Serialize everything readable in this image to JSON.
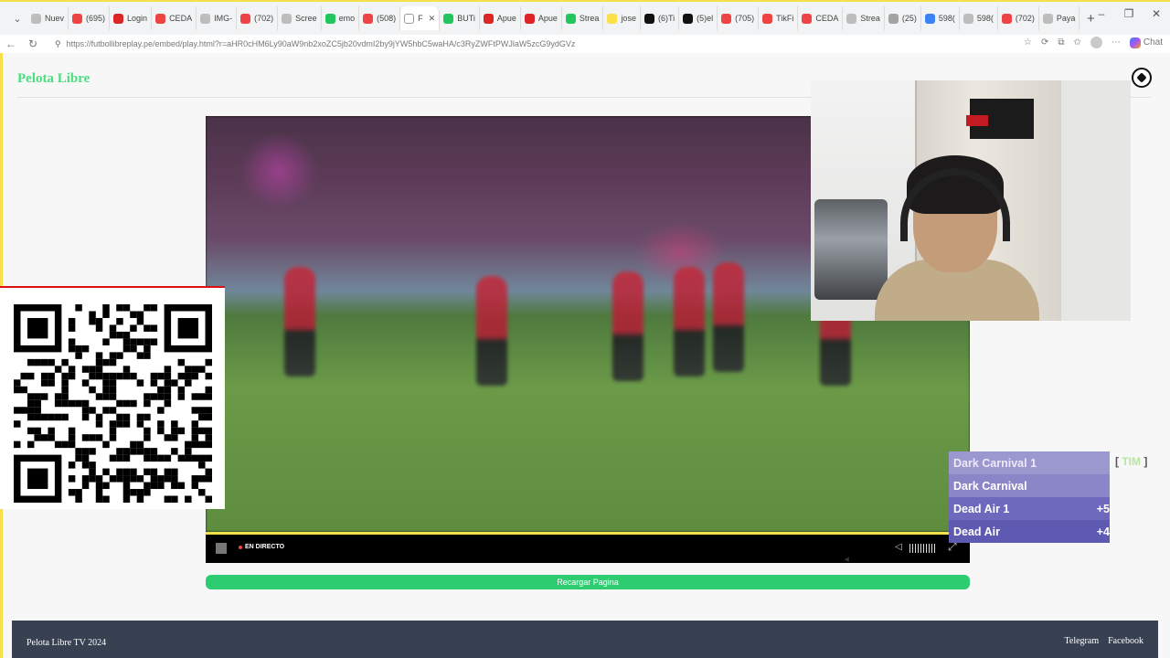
{
  "browser": {
    "tabs": [
      {
        "label": "Nuev",
        "color": "#bdbdbd"
      },
      {
        "label": "(695)",
        "color": "#ef4444"
      },
      {
        "label": "Login",
        "color": "#dc2626"
      },
      {
        "label": "CEDA",
        "color": "#ef4444"
      },
      {
        "label": "IMG-",
        "color": "#bdbdbd"
      },
      {
        "label": "(702)",
        "color": "#ef4444"
      },
      {
        "label": "Scree",
        "color": "#bdbdbd"
      },
      {
        "label": "emo",
        "color": "#22c55e"
      },
      {
        "label": "(508)",
        "color": "#ef4444"
      },
      {
        "label": "F",
        "color": "#ffffff",
        "active": true
      },
      {
        "label": "BUTi",
        "color": "#22c55e"
      },
      {
        "label": "Apue",
        "color": "#dc2626"
      },
      {
        "label": "Apue",
        "color": "#dc2626"
      },
      {
        "label": "Strea",
        "color": "#22c55e"
      },
      {
        "label": "jose",
        "color": "#fde047"
      },
      {
        "label": "(6)Ti",
        "color": "#111111"
      },
      {
        "label": "(5)el",
        "color": "#111111"
      },
      {
        "label": "(705)",
        "color": "#ef4444"
      },
      {
        "label": "TikFi",
        "color": "#ef4444"
      },
      {
        "label": "CEDA",
        "color": "#ef4444"
      },
      {
        "label": "Strea",
        "color": "#bdbdbd"
      },
      {
        "label": "(25)",
        "color": "#a3a3a3"
      },
      {
        "label": "598(",
        "color": "#3b82f6"
      },
      {
        "label": "598(",
        "color": "#bdbdbd"
      },
      {
        "label": "(702)",
        "color": "#ef4444"
      },
      {
        "label": "Paya",
        "color": "#bdbdbd"
      }
    ],
    "url": "https://futbollibreplay.pe/embed/play.html?r=aHR0cHM6Ly90aW9nb2xoZC5jb20vdmI2by9jYW5hbC5waHA/c3RyZWFtPWJlaW5zcG9ydGVz",
    "chat_label": "Chat"
  },
  "site": {
    "brand": "Pelota Libre",
    "reload_label": "Recargar Pagina",
    "footer_left": "Pelota Libre TV 2024",
    "footer_links": [
      "Telegram",
      "Facebook"
    ]
  },
  "player": {
    "live_label": "EN DIRECTO",
    "progress_fraction": 1.0
  },
  "leaderboard": {
    "rows": [
      {
        "name": "Dark Carnival 1",
        "score": ""
      },
      {
        "name": "Dark Carnival",
        "score": ""
      },
      {
        "name": "Dead Air 1",
        "score": "+5"
      },
      {
        "name": "Dead Air",
        "score": "+4"
      }
    ],
    "bracket_text": "TIM"
  },
  "colors": {
    "brand": "#4ade80",
    "reload": "#2ecc71",
    "footer_bg": "#374151",
    "highlight": "#f3e04b"
  }
}
